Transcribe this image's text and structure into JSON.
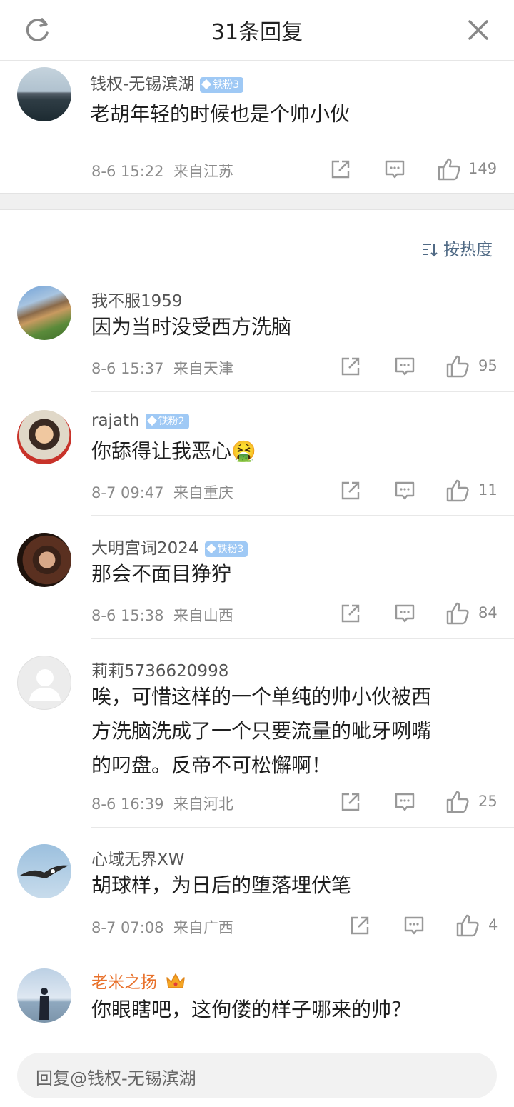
{
  "header": {
    "title": "31条回复"
  },
  "main_comment": {
    "user": "钱权-无锡滨湖",
    "badge": "铁粉3",
    "text": "老胡年轻的时候也是个帅小伙",
    "time": "8-6 15:22",
    "location": "来自江苏",
    "likes": "149"
  },
  "sort": {
    "label": "按热度"
  },
  "replies": [
    {
      "user": "我不服1959",
      "text": "因为当时没受西方洗脑",
      "time": "8-6 15:37",
      "location": "来自天津",
      "likes": "95"
    },
    {
      "user": "rajath",
      "badge": "铁粉2",
      "text": "你舔得让我恶心🤮",
      "time": "8-7 09:47",
      "location": "来自重庆",
      "likes": "11"
    },
    {
      "user": "大明宫词2024",
      "badge": "铁粉3",
      "text": "那会不面目狰狞",
      "time": "8-6 15:38",
      "location": "来自山西",
      "likes": "84"
    },
    {
      "user": "莉莉5736620998",
      "text_lines": [
        "唉，可惜这样的一个单纯的帅小伙被西",
        "方洗脑洗成了一个只要流量的呲牙咧嘴",
        "的叼盘。反帝不可松懈啊！"
      ],
      "time": "8-6 16:39",
      "location": "来自河北",
      "likes": "25"
    },
    {
      "user": "心域无界XW",
      "text": "胡球样，为日后的堕落埋伏笔",
      "time": "8-7 07:08",
      "location": "来自广西",
      "likes": "4"
    },
    {
      "user": "老米之扬",
      "text": "你眼瞎吧，这佝偻的样子哪来的帅？"
    }
  ],
  "reply_box": {
    "placeholder": "回复@钱权-无锡滨湖"
  },
  "colors": {
    "badge": "#9fc9f5",
    "gold_name": "#e8712b",
    "sort": "#506a85"
  }
}
